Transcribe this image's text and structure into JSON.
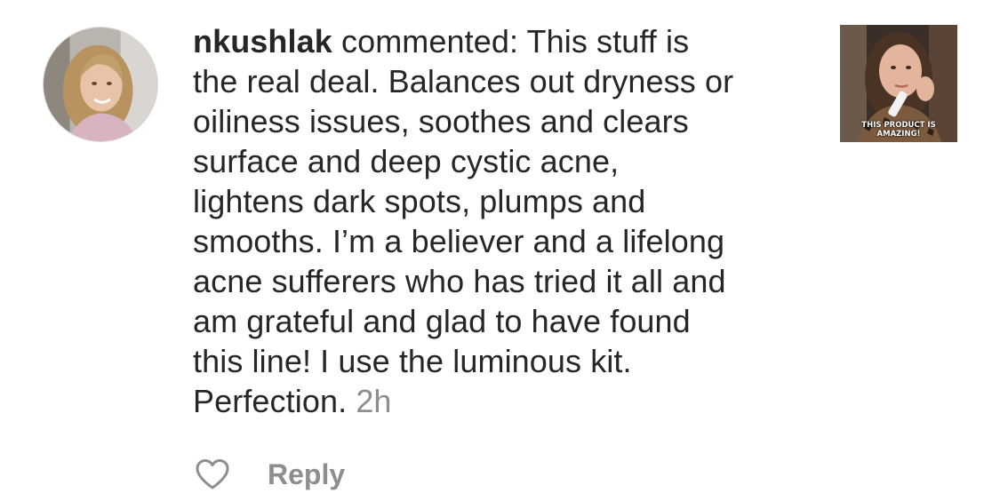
{
  "comment": {
    "username": "nkushlak",
    "verb": "commented:",
    "lines": [
      "This stuff is",
      "the real deal. Balances out dryness or",
      "oiliness issues, soothes and clears",
      "surface and deep cystic acne,",
      "lightens dark spots, plumps and",
      "smooths. I’m a believer and a lifelong",
      "acne sufferers who has tried it all and",
      "am grateful and glad to have found",
      "this line! I use the luminous kit.",
      "Perfection."
    ],
    "timestamp": "2h"
  },
  "thumbnail": {
    "caption_line1": "THIS PRODUCT IS",
    "caption_line2": "AMAZING!"
  },
  "actions": {
    "like_icon": "heart-outline-icon",
    "reply_label": "Reply"
  },
  "colors": {
    "text": "#262626",
    "muted": "#8e8e8e",
    "background": "#ffffff"
  }
}
